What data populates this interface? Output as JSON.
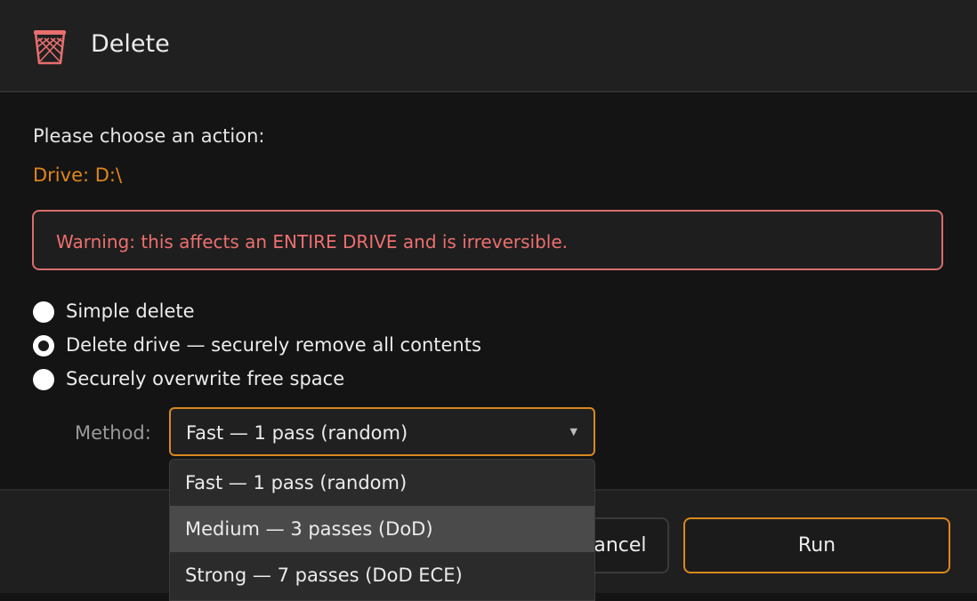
{
  "dialog": {
    "title": "Delete",
    "icon": "wastebasket-icon",
    "prompt": "Please choose an action:",
    "drive": "Drive: D:\\",
    "warning": "Warning: this affects an ENTIRE DRIVE and is irreversible.",
    "accent_color": "#d9881e",
    "warning_color": "#ee6f6f"
  },
  "options": [
    {
      "label": "Simple delete",
      "selected": false
    },
    {
      "label": "Delete drive — securely remove all contents",
      "selected": true
    },
    {
      "label": "Securely overwrite free space",
      "selected": false
    }
  ],
  "method": {
    "label": "Method:",
    "value": "Fast — 1 pass (random)",
    "options": [
      {
        "label": "Fast — 1 pass (random)",
        "hovered": false
      },
      {
        "label": "Medium — 3 passes (DoD)",
        "hovered": true
      },
      {
        "label": "Strong — 7 passes (DoD ECE)",
        "hovered": false
      }
    ]
  },
  "buttons": {
    "cancel": "Cancel",
    "run": "Run"
  }
}
